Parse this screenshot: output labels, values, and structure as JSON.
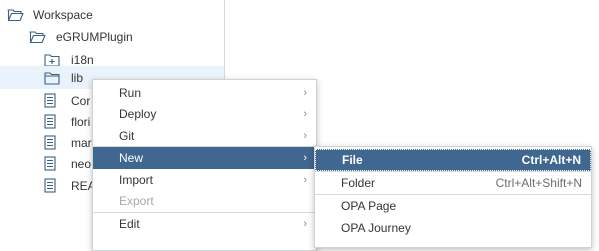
{
  "tree": {
    "items": [
      {
        "label": "Workspace",
        "icon": "folder-open-icon"
      },
      {
        "label": "eGRUMPlugin",
        "icon": "folder-open-icon"
      },
      {
        "label": "i18n",
        "icon": "folder-plus-icon"
      },
      {
        "label": "lib",
        "icon": "folder-icon"
      },
      {
        "label": "Cor",
        "icon": "document-icon"
      },
      {
        "label": "flori",
        "icon": "document-icon"
      },
      {
        "label": "mar",
        "icon": "document-icon"
      },
      {
        "label": "neo",
        "icon": "document-icon"
      },
      {
        "label": "REA",
        "icon": "document-icon"
      }
    ]
  },
  "context_menu": {
    "items": [
      {
        "label": "Run",
        "submenu": true
      },
      {
        "label": "Deploy",
        "submenu": true
      },
      {
        "label": "Git",
        "submenu": true
      },
      {
        "label": "New",
        "submenu": true,
        "active": true
      },
      {
        "label": "Import",
        "submenu": true
      },
      {
        "label": "Export",
        "disabled": true
      },
      {
        "label": "Edit",
        "submenu": true
      }
    ]
  },
  "submenu": {
    "items": [
      {
        "label": "File",
        "shortcut": "Ctrl+Alt+N",
        "active": true
      },
      {
        "label": "Folder",
        "shortcut": "Ctrl+Alt+Shift+N"
      },
      {
        "label": "OPA Page",
        "shortcut": ""
      },
      {
        "label": "OPA Journey",
        "shortcut": ""
      }
    ]
  },
  "colors": {
    "accent": "#3f678f",
    "selection": "#eaf2fb"
  }
}
